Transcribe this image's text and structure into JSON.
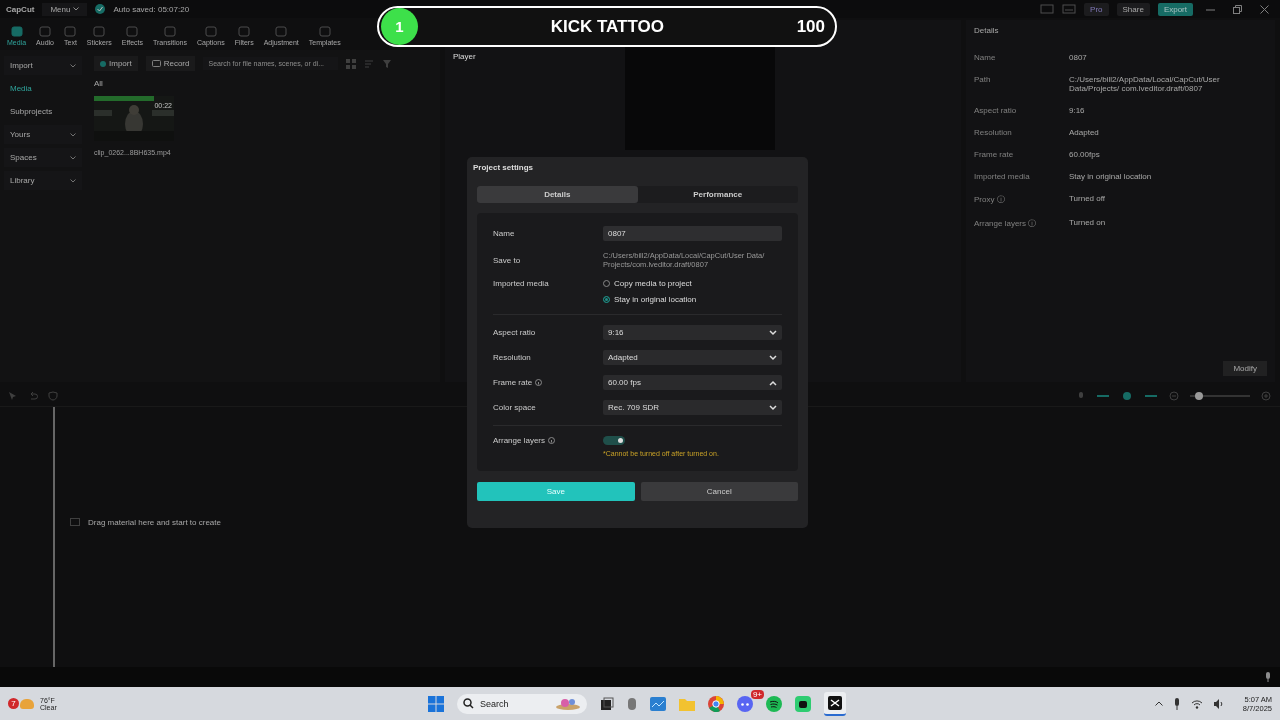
{
  "app": {
    "logo": "CapCut",
    "menu": "Menu",
    "autosave": "Auto saved: 05:07:20",
    "pro": "Pro",
    "share": "Share",
    "export": "Export"
  },
  "toolbar": [
    {
      "label": "Media",
      "selected": true
    },
    {
      "label": "Audio",
      "selected": false
    },
    {
      "label": "Text",
      "selected": false
    },
    {
      "label": "Stickers",
      "selected": false
    },
    {
      "label": "Effects",
      "selected": false
    },
    {
      "label": "Transitions",
      "selected": false
    },
    {
      "label": "Captions",
      "selected": false
    },
    {
      "label": "Filters",
      "selected": false
    },
    {
      "label": "Adjustment",
      "selected": false
    },
    {
      "label": "Templates",
      "selected": false
    }
  ],
  "sidebar": [
    {
      "label": "Import",
      "selected": false,
      "expandable": true
    },
    {
      "label": "Media",
      "selected": true,
      "expandable": false
    },
    {
      "label": "Subprojects",
      "selected": false,
      "expandable": false
    },
    {
      "label": "Yours",
      "selected": false,
      "expandable": true
    },
    {
      "label": "Spaces",
      "selected": false,
      "expandable": true
    },
    {
      "label": "Library",
      "selected": false,
      "expandable": true
    }
  ],
  "media": {
    "import": "Import",
    "record": "Record",
    "search_placeholder": "Search for file names, scenes, or di...",
    "filter": "All",
    "clip": {
      "kind": "picture",
      "duration": "00:22",
      "name": "clip_0262...8BH635.mp4"
    }
  },
  "player": {
    "title": "Player"
  },
  "details": {
    "title": "Details",
    "rows": [
      {
        "label": "Name",
        "value": "0807"
      },
      {
        "label": "Path",
        "value": "C:/Users/bill2/AppData/Local/CapCut/User Data/Projects/ com.lveditor.draft/0807"
      },
      {
        "label": "Aspect ratio",
        "value": "9:16"
      },
      {
        "label": "Resolution",
        "value": "Adapted"
      },
      {
        "label": "Frame rate",
        "value": "60.00fps"
      },
      {
        "label": "Imported media",
        "value": "Stay in original location"
      },
      {
        "label": "Proxy ⓘ",
        "value": "Turned off"
      },
      {
        "label": "Arrange layers ⓘ",
        "value": "Turned on"
      }
    ],
    "modify": "Modify"
  },
  "timeline": {
    "hint": "Drag material here and start to create",
    "zoom": {
      "level": 0.15
    }
  },
  "dialog": {
    "title": "Project settings",
    "tabs": [
      {
        "label": "Details",
        "selected": true
      },
      {
        "label": "Performance",
        "selected": false
      }
    ],
    "name": {
      "label": "Name",
      "value": "0807"
    },
    "save_to": {
      "label": "Save to",
      "value": "C:/Users/bill2/AppData/Local/CapCut/User Data/ Projects/com.lveditor.draft/0807"
    },
    "imported_media": {
      "label": "Imported media",
      "options": [
        {
          "label": "Copy media to project",
          "selected": false
        },
        {
          "label": "Stay in original location",
          "selected": true
        }
      ]
    },
    "selects": [
      {
        "label": "Aspect ratio",
        "help": false,
        "value": "9:16",
        "expanded": false
      },
      {
        "label": "Resolution",
        "help": false,
        "value": "Adapted",
        "expanded": false
      },
      {
        "label": "Frame rate",
        "help": true,
        "value": "60.00 fps",
        "expanded": true
      },
      {
        "label": "Color space",
        "help": false,
        "value": "Rec. 709 SDR",
        "expanded": false
      }
    ],
    "arrange_layers": {
      "label": "Arrange layers",
      "on": true,
      "note": "*Cannot be turned off after turned on."
    },
    "save": "Save",
    "cancel": "Cancel"
  },
  "overlay_banner": {
    "rank": "1",
    "title": "KICK TATTOO",
    "score": "100"
  },
  "taskbar": {
    "weather_badge": "7",
    "temperature": "76°F",
    "condition": "Clear",
    "search": "Search",
    "discord_badge": "9+",
    "time": "5:07 AM",
    "date": "8/7/2025"
  }
}
